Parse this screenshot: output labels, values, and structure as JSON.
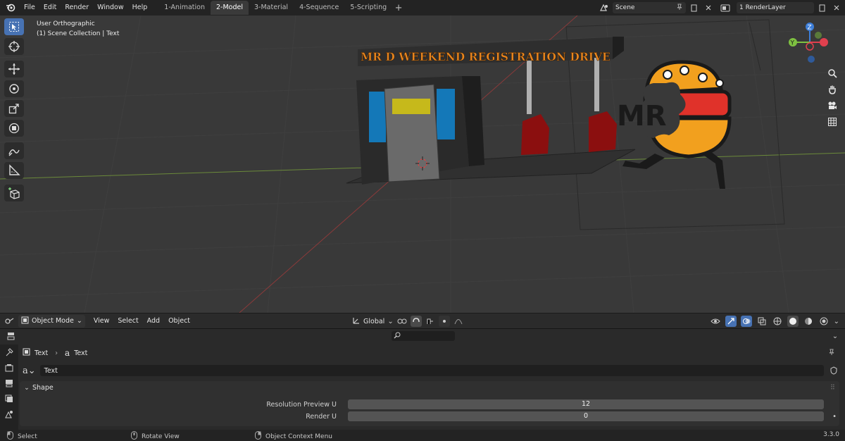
{
  "top_menu": [
    "File",
    "Edit",
    "Render",
    "Window",
    "Help"
  ],
  "workspace_tabs": [
    {
      "label": "1-Animation",
      "active": false
    },
    {
      "label": "2-Model",
      "active": true
    },
    {
      "label": "3-Material",
      "active": false
    },
    {
      "label": "4-Sequence",
      "active": false
    },
    {
      "label": "5-Scripting",
      "active": false
    }
  ],
  "scene": {
    "name": "Scene"
  },
  "view_layer": {
    "name": "1 RenderLayer"
  },
  "viewport": {
    "view_name": "User Orthographic",
    "collection_info": "(1) Scene Collection | Text",
    "sign_text": "MR D WEEKEND REGISTRATION DRIVE",
    "logo_text": "MR",
    "gizmo_axes": {
      "z": "Z",
      "y": "Y"
    }
  },
  "header": {
    "mode": "Object Mode",
    "menus": [
      "View",
      "Select",
      "Add",
      "Object"
    ],
    "transform_orientation": "Global"
  },
  "properties": {
    "breadcrumb": [
      "Text",
      "Text"
    ],
    "datablock_name": "Text",
    "panel_title": "Shape",
    "rows": [
      {
        "label": "Resolution Preview U",
        "value": "12"
      },
      {
        "label": "Render U",
        "value": "0"
      }
    ]
  },
  "status_bar": {
    "select": "Select",
    "rotate": "Rotate View",
    "context_menu": "Object Context Menu",
    "version": "3.3.0"
  },
  "colors": {
    "active_tool": "#4772b3",
    "sign_text": "#e8861f",
    "burger_orange": "#f2a01e",
    "burger_red": "#e0322a",
    "pump_red": "#8b0f0f",
    "axis_x": "#e0404e",
    "axis_y": "#7ec141",
    "axis_z": "#3d7ed8"
  }
}
